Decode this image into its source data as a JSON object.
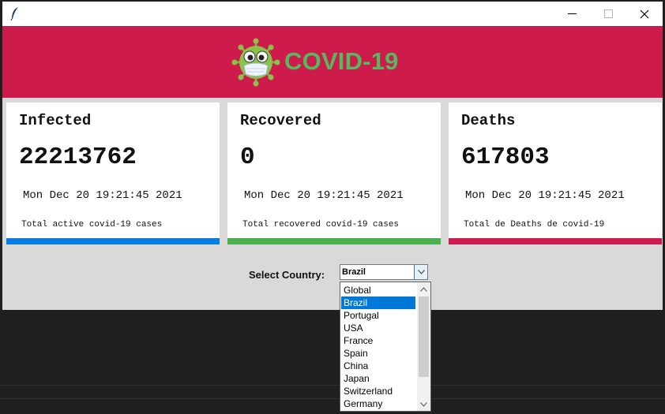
{
  "window": {
    "icon": "feather-icon",
    "controls": [
      "minimize-icon",
      "maximize-icon",
      "close-icon"
    ]
  },
  "header": {
    "logo": "virus-icon",
    "title": "COVID-19",
    "colors": {
      "background": "#cd1c4c",
      "title": "#56b85f"
    }
  },
  "cards": [
    {
      "title": "Infected",
      "value": "22213762",
      "date": "Mon Dec 20 19:21:45 2021",
      "description": "Total active covid-19 cases",
      "accent": "#0a7ee0"
    },
    {
      "title": "Recovered",
      "value": "0",
      "date": "Mon Dec 20 19:21:45 2021",
      "description": "Total recovered covid-19 cases",
      "accent": "#4caf50"
    },
    {
      "title": "Deaths",
      "value": "617803",
      "date": "Mon Dec 20 19:21:45 2021",
      "description": "Total de Deaths de covid-19",
      "accent": "#cd1c4c"
    }
  ],
  "country_select": {
    "label": "Select Country:",
    "selected": "Brazil",
    "options": [
      "Global",
      "Brazil",
      "Portugal",
      "USA",
      "France",
      "Spain",
      "China",
      "Japan",
      "Switzerland",
      "Germany"
    ]
  }
}
